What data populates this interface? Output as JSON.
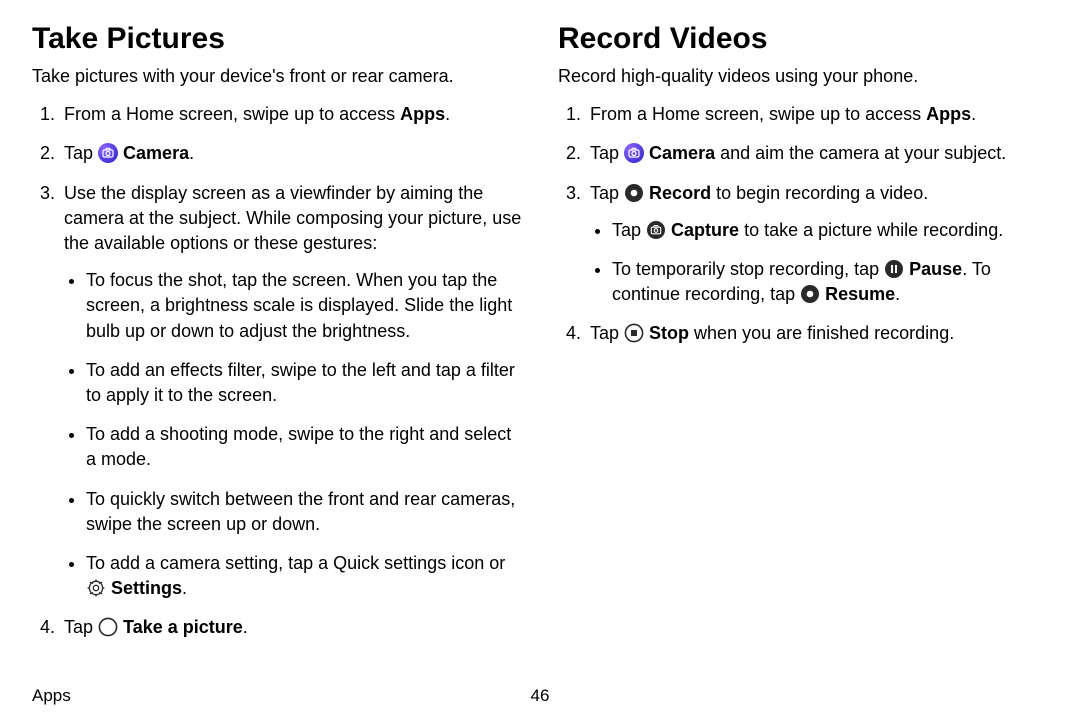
{
  "footer": {
    "section": "Apps",
    "page": "46"
  },
  "sec1": {
    "title": "Take Pictures",
    "intro": "Take pictures with your device's front or rear camera.",
    "steps": {
      "s1_a": "From a Home screen, swipe up to access ",
      "s1_apps": "Apps",
      "s1_b": ".",
      "s2_a": "Tap ",
      "s2_camera": "Camera",
      "s2_b": ".",
      "s3": "Use the display screen as a viewfinder by aiming the camera at the subject. While composing your picture, use the available options or these gestures:",
      "s3_bullets": {
        "b1": "To focus the shot, tap the screen. When you tap the screen, a brightness scale is displayed. Slide the light bulb up or down to adjust the brightness.",
        "b2": "To add an effects filter, swipe to the left and tap a filter to apply it to the screen.",
        "b3": "To add a shooting mode, swipe to the right and select a mode.",
        "b4": "To quickly switch between the front and rear cameras, swipe the screen up or down.",
        "b5_a": "To add a camera setting, tap a Quick settings icon or ",
        "b5_settings": "Settings",
        "b5_b": "."
      },
      "s4_a": "Tap ",
      "s4_take": "Take a picture",
      "s4_b": "."
    }
  },
  "sec2": {
    "title": "Record Videos",
    "intro": "Record high-quality videos using your phone.",
    "steps": {
      "s1_a": "From a Home screen, swipe up to access ",
      "s1_apps": "Apps",
      "s1_b": ".",
      "s2_a": "Tap ",
      "s2_camera": "Camera",
      "s2_b": " and aim the camera at your subject.",
      "s3_a": "Tap ",
      "s3_record": "Record",
      "s3_b": " to begin recording a video.",
      "s3_bullets": {
        "b1_a": "Tap ",
        "b1_capture": "Capture",
        "b1_b": " to take a picture while recording.",
        "b2_a": "To temporarily stop recording, tap ",
        "b2_pause": "Pause",
        "b2_b": ". To continue recording, tap ",
        "b2_resume": "Resume",
        "b2_c": "."
      },
      "s4_a": "Tap ",
      "s4_stop": "Stop",
      "s4_b": " when you are finished recording."
    }
  }
}
